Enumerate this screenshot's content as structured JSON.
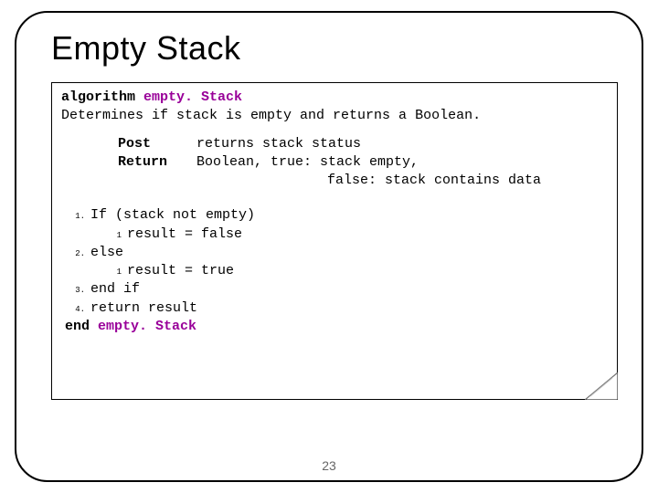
{
  "title": "Empty Stack",
  "page_number": "23",
  "algo": {
    "keyword_algorithm": "algorithm",
    "name": "empty. Stack",
    "desc": "Determines if stack is empty and returns a Boolean.",
    "post_label": "Post",
    "post_text": "returns stack status",
    "return_label": "Return",
    "return_text": "Boolean, true: stack empty,",
    "return_cont": "         false: stack contains data",
    "steps": {
      "n1": "1.",
      "s1": "If (stack not empty)",
      "n1a": "1",
      "s1a": "result = false",
      "n2": "2.",
      "s2": "else",
      "n2a": "1",
      "s2a": "result = true",
      "n3": "3.",
      "s3": "end if",
      "n4": "4.",
      "s4": "return result",
      "end_kw": "end",
      "end_name": "empty. Stack"
    }
  }
}
